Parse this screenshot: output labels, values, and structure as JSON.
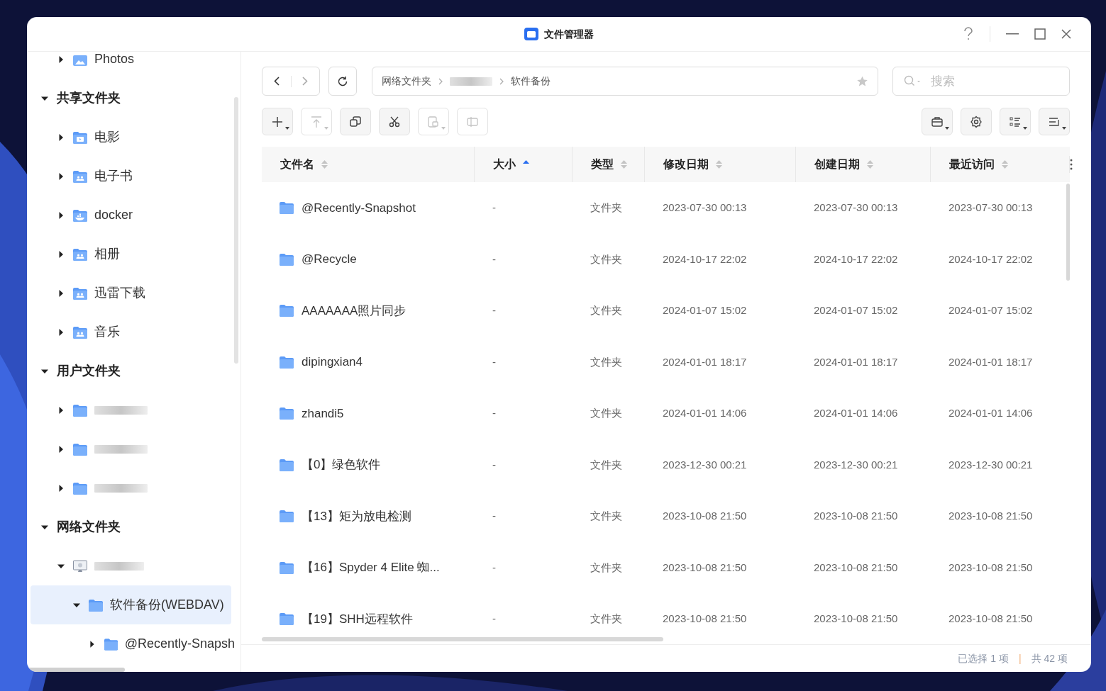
{
  "window": {
    "title": "文件管理器"
  },
  "sidebar": {
    "items": [
      {
        "label": "Photos",
        "kind": "photos",
        "expanded": false
      },
      {
        "label": "共享文件夹",
        "kind": "group",
        "expanded": true,
        "children": [
          {
            "label": "电影",
            "kind": "movie",
            "expanded": false
          },
          {
            "label": "电子书",
            "kind": "shared",
            "expanded": false
          },
          {
            "label": "docker",
            "kind": "docker",
            "expanded": false
          },
          {
            "label": "相册",
            "kind": "shared",
            "expanded": false
          },
          {
            "label": "迅雷下载",
            "kind": "shared",
            "expanded": false
          },
          {
            "label": "音乐",
            "kind": "shared",
            "expanded": false
          }
        ]
      },
      {
        "label": "用户文件夹",
        "kind": "group",
        "expanded": true,
        "children": [
          {
            "kind": "folder",
            "expanded": false
          },
          {
            "kind": "folder",
            "expanded": false
          },
          {
            "kind": "folder",
            "expanded": false
          }
        ]
      },
      {
        "label": "网络文件夹",
        "kind": "group",
        "expanded": true,
        "children": [
          {
            "kind": "computer",
            "expanded": true,
            "children": [
              {
                "label": "软件备份(WEBDAV)",
                "kind": "folder",
                "expanded": true,
                "selected": true,
                "children": [
                  {
                    "label": "@Recently-Snapsh",
                    "kind": "folder",
                    "expanded": false,
                    "selected": false
                  }
                ]
              }
            ]
          }
        ]
      }
    ]
  },
  "breadcrumb": [
    {
      "kind": "crumb",
      "label": "网络文件夹"
    },
    {
      "kind": "blurred"
    },
    {
      "kind": "crumb",
      "label": "软件备份"
    }
  ],
  "search": {
    "placeholder": "搜索"
  },
  "toolbar": {
    "left": [
      {
        "kind": "plus",
        "caret": true,
        "disabled": false
      },
      {
        "kind": "upload",
        "caret": true,
        "disabled": true
      },
      {
        "kind": "copy",
        "caret": false,
        "disabled": false
      },
      {
        "kind": "cut",
        "caret": false,
        "disabled": false
      },
      {
        "kind": "paste",
        "caret": true,
        "disabled": true
      },
      {
        "kind": "rename",
        "caret": false,
        "disabled": true
      }
    ],
    "right": [
      {
        "kind": "briefcase",
        "caret": true,
        "disabled": false
      },
      {
        "kind": "gear",
        "caret": false,
        "disabled": false
      },
      {
        "kind": "list",
        "caret": true,
        "disabled": false
      },
      {
        "kind": "sort",
        "caret": true,
        "disabled": false
      }
    ]
  },
  "table": {
    "columns": [
      {
        "label": "文件名",
        "sorted": false
      },
      {
        "label": "大小",
        "sorted": true
      },
      {
        "label": "类型",
        "sorted": false
      },
      {
        "label": "修改日期",
        "sorted": false
      },
      {
        "label": "创建日期",
        "sorted": false
      },
      {
        "label": "最近访问",
        "sorted": false
      }
    ],
    "rows": [
      {
        "name": "@Recently-Snapshot",
        "size": "-",
        "type": "文件夹",
        "modified": "2023-07-30 00:13",
        "created": "2023-07-30 00:13",
        "accessed": "2023-07-30 00:13"
      },
      {
        "name": "@Recycle",
        "size": "-",
        "type": "文件夹",
        "modified": "2024-10-17 22:02",
        "created": "2024-10-17 22:02",
        "accessed": "2024-10-17 22:02"
      },
      {
        "name": "AAAAAAA照片同步",
        "size": "-",
        "type": "文件夹",
        "modified": "2024-01-07 15:02",
        "created": "2024-01-07 15:02",
        "accessed": "2024-01-07 15:02"
      },
      {
        "name": "dipingxian4",
        "size": "-",
        "type": "文件夹",
        "modified": "2024-01-01 18:17",
        "created": "2024-01-01 18:17",
        "accessed": "2024-01-01 18:17"
      },
      {
        "name": "zhandi5",
        "size": "-",
        "type": "文件夹",
        "modified": "2024-01-01 14:06",
        "created": "2024-01-01 14:06",
        "accessed": "2024-01-01 14:06"
      },
      {
        "name": "【0】绿色软件",
        "size": "-",
        "type": "文件夹",
        "modified": "2023-12-30 00:21",
        "created": "2023-12-30 00:21",
        "accessed": "2023-12-30 00:21"
      },
      {
        "name": "【13】矩为放电检测",
        "size": "-",
        "type": "文件夹",
        "modified": "2023-10-08 21:50",
        "created": "2023-10-08 21:50",
        "accessed": "2023-10-08 21:50"
      },
      {
        "name": "【16】Spyder 4 Elite 蜘...",
        "size": "-",
        "type": "文件夹",
        "modified": "2023-10-08 21:50",
        "created": "2023-10-08 21:50",
        "accessed": "2023-10-08 21:50"
      },
      {
        "name": "【19】SHH远程软件",
        "size": "-",
        "type": "文件夹",
        "modified": "2023-10-08 21:50",
        "created": "2023-10-08 21:50",
        "accessed": "2023-10-08 21:50"
      }
    ]
  },
  "status_bar": {
    "selected": "已选择 1 项",
    "separator": "|",
    "total": "共 42 项"
  }
}
